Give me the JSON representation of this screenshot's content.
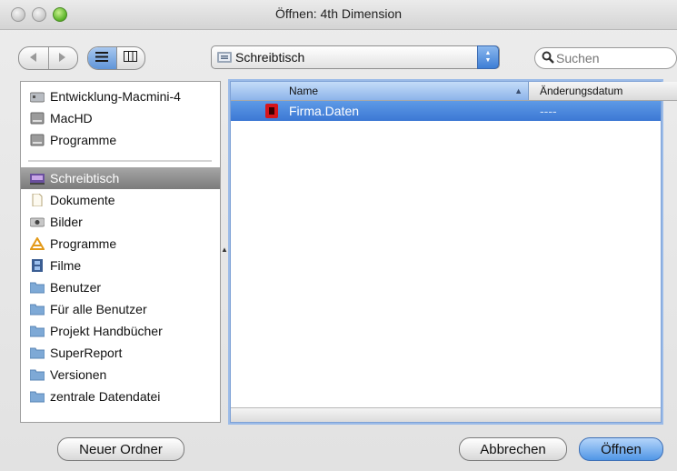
{
  "window": {
    "title": "Öffnen: 4th Dimension"
  },
  "toolbar": {
    "nav_back_icon": "chevron-left",
    "nav_forward_icon": "chevron-right",
    "location": "Schreibtisch",
    "search_placeholder": "Suchen"
  },
  "sidebar": {
    "devices": [
      {
        "label": "Entwicklung-Macmini-4",
        "icon": "network-drive-icon"
      },
      {
        "label": "MacHD",
        "icon": "hard-drive-icon"
      },
      {
        "label": "Programme",
        "icon": "hard-drive-icon"
      }
    ],
    "places": [
      {
        "label": "Schreibtisch",
        "icon": "desktop-icon",
        "selected": true
      },
      {
        "label": "Dokumente",
        "icon": "document-icon"
      },
      {
        "label": "Bilder",
        "icon": "pictures-icon"
      },
      {
        "label": "Programme",
        "icon": "applications-icon"
      },
      {
        "label": "Filme",
        "icon": "movies-icon"
      },
      {
        "label": "Benutzer",
        "icon": "folder-icon"
      },
      {
        "label": "Für alle Benutzer",
        "icon": "folder-icon"
      },
      {
        "label": "Projekt Handbücher",
        "icon": "folder-icon"
      },
      {
        "label": "SuperReport",
        "icon": "folder-icon"
      },
      {
        "label": "Versionen",
        "icon": "folder-icon"
      },
      {
        "label": "zentrale Datendatei",
        "icon": "folder-icon"
      }
    ]
  },
  "filelist": {
    "columns": {
      "name": "Name",
      "date": "Änderungsdatum"
    },
    "rows": [
      {
        "name": "Firma.Daten",
        "date": "----",
        "selected": true
      }
    ]
  },
  "buttons": {
    "new_folder": "Neuer Ordner",
    "cancel": "Abbrechen",
    "open": "Öffnen"
  },
  "colors": {
    "selection": "#3c78d4",
    "sidebar_selection": "#7b7b7b",
    "file_icon": "#d7161b"
  }
}
